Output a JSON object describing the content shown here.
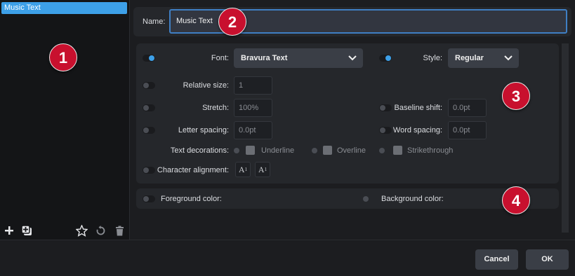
{
  "styles_list": {
    "items": [
      {
        "label": "Music Text",
        "selected": true
      }
    ]
  },
  "left_toolbar": {
    "icons": [
      "plus-icon",
      "duplicate-icon",
      "star-icon",
      "revert-icon",
      "trash-icon"
    ]
  },
  "name": {
    "label": "Name:",
    "value": "Music Text"
  },
  "font_panel": {
    "font": {
      "label": "Font:",
      "value": "Bravura Text",
      "enabled": true
    },
    "style": {
      "label": "Style:",
      "value": "Regular",
      "enabled": true
    },
    "relative_size": {
      "label": "Relative size:",
      "value": "1",
      "enabled": false
    },
    "stretch": {
      "label": "Stretch:",
      "value": "100%",
      "enabled": false
    },
    "baseline_shift": {
      "label": "Baseline shift:",
      "value": "0.0pt",
      "enabled": false
    },
    "letter_spacing": {
      "label": "Letter spacing:",
      "value": "0.0pt",
      "enabled": false
    },
    "word_spacing": {
      "label": "Word spacing:",
      "value": "0.0pt",
      "enabled": false
    },
    "text_decorations": {
      "label": "Text decorations:",
      "underline": "Underline",
      "overline": "Overline",
      "strikethrough": "Strikethrough"
    },
    "character_alignment": {
      "label": "Character alignment:",
      "options": [
        "A",
        "1",
        "A",
        "1"
      ]
    }
  },
  "color_panel": {
    "foreground": {
      "label": "Foreground color:",
      "enabled": false
    },
    "background": {
      "label": "Background color:",
      "enabled": false
    }
  },
  "footer": {
    "cancel_label": "Cancel",
    "ok_label": "OK"
  },
  "callouts": [
    "1",
    "2",
    "3",
    "4"
  ],
  "colors": {
    "accent": "#3da0e8",
    "callout": "#c8102e",
    "focus": "#3f7fc4"
  }
}
